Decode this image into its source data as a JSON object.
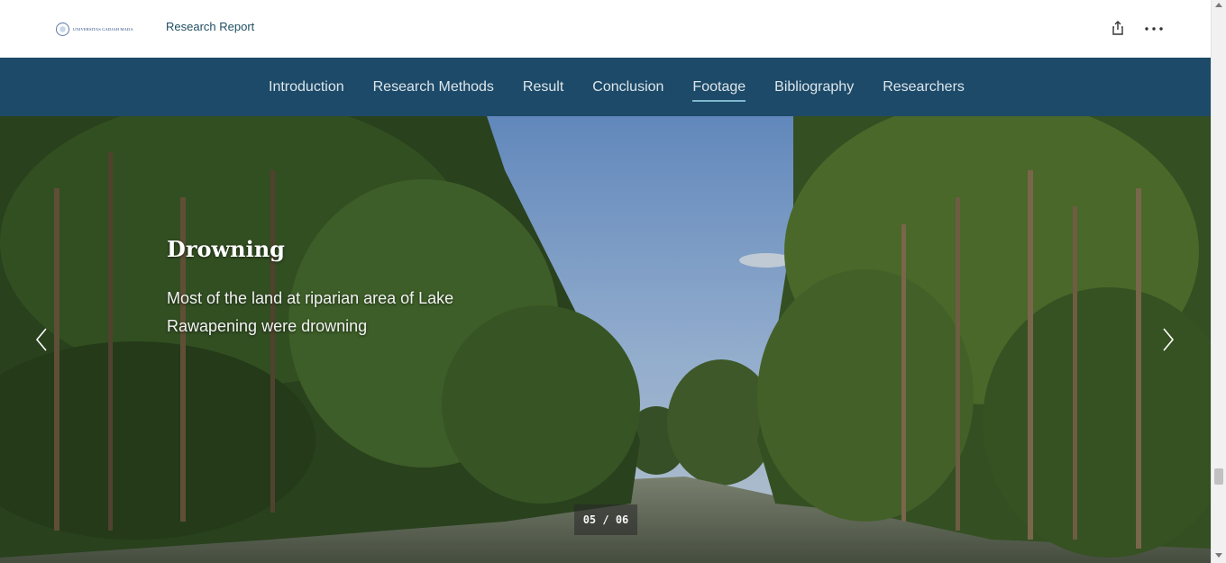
{
  "header": {
    "logo_text": "UNIVERSITAS GADJAH MADA",
    "report_title": "Research Report",
    "share_icon": "share-icon",
    "more_icon": "more-icon"
  },
  "nav": {
    "items": [
      {
        "label": "Introduction",
        "active": false
      },
      {
        "label": "Research Methods",
        "active": false
      },
      {
        "label": "Result",
        "active": false
      },
      {
        "label": "Conclusion",
        "active": false
      },
      {
        "label": "Footage",
        "active": true
      },
      {
        "label": "Bibliography",
        "active": false
      },
      {
        "label": "Researchers",
        "active": false
      }
    ]
  },
  "slide": {
    "heading": "Drowning",
    "caption": "Most of the land at riparian area of Lake Rawapening were drowning",
    "counter": "05 / 06",
    "prev_icon": "chevron-left-icon",
    "next_icon": "chevron-right-icon"
  },
  "colors": {
    "nav_background": "#1d4a68",
    "nav_text": "#dce6ec",
    "active_underline": "#7fb8cc",
    "title_text": "#1f4f63"
  }
}
